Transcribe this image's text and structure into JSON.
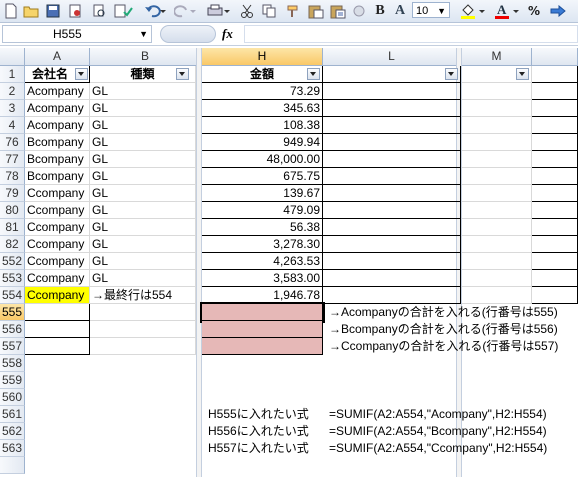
{
  "toolbar": {
    "font_size": "10",
    "buttons": [
      "new-icon",
      "open-icon",
      "save-icon",
      "permission-icon",
      "print-preview-icon",
      "spelling-icon",
      "undo-icon",
      "redo-icon",
      "print-icon",
      "cut-icon",
      "copy-icon",
      "format-painter-icon",
      "paste-icon",
      "paste-special-icon",
      "circle-icon",
      "bold-icon",
      "font-icon",
      "font-color-icon",
      "percent-icon",
      "arrow-icon"
    ],
    "bold_label": "B",
    "font_label": "A",
    "percent_label": "%"
  },
  "formula_bar": {
    "name_box": "H555",
    "fx_label": "fx",
    "value": ""
  },
  "columns": [
    {
      "label": "A"
    },
    {
      "label": "B"
    },
    {
      "label": "H"
    },
    {
      "label": "L"
    },
    {
      "label": "M"
    }
  ],
  "header_row": {
    "row": "1",
    "a": "会社名",
    "b": "種類",
    "h": "金額",
    "l": "",
    "m": ""
  },
  "data_rows": [
    {
      "row": "2",
      "a": "Acompany",
      "b": "GL",
      "h": "73.29"
    },
    {
      "row": "3",
      "a": "Acompany",
      "b": "GL",
      "h": "345.63"
    },
    {
      "row": "4",
      "a": "Acompany",
      "b": "GL",
      "h": "108.38"
    },
    {
      "row": "76",
      "a": "Bcompany",
      "b": "GL",
      "h": "949.94"
    },
    {
      "row": "77",
      "a": "Bcompany",
      "b": "GL",
      "h": "48,000.00"
    },
    {
      "row": "78",
      "a": "Bcompany",
      "b": "GL",
      "h": "675.75"
    },
    {
      "row": "79",
      "a": "Ccompany",
      "b": "GL",
      "h": "139.67"
    },
    {
      "row": "80",
      "a": "Ccompany",
      "b": "GL",
      "h": "479.09"
    },
    {
      "row": "81",
      "a": "Ccompany",
      "b": "GL",
      "h": "56.38"
    },
    {
      "row": "82",
      "a": "Ccompany",
      "b": "GL",
      "h": "3,278.30"
    },
    {
      "row": "552",
      "a": "Ccompany",
      "b": "GL",
      "h": "4,263.53"
    },
    {
      "row": "553",
      "a": "Ccompany",
      "b": "GL",
      "h": "3,583.00"
    },
    {
      "row": "554",
      "a": "Ccompany",
      "b": "→最終行は554",
      "h": "1,946.78"
    }
  ],
  "sum_rows": [
    {
      "row": "555",
      "note": "→Acompanyの合計を入れる(行番号は555)"
    },
    {
      "row": "556",
      "note": "→Bcompanyの合計を入れる(行番号は556)"
    },
    {
      "row": "557",
      "note": "→Ccompanyの合計を入れる(行番号は557)"
    }
  ],
  "empty_rows": [
    "558",
    "559",
    "560"
  ],
  "formula_rows": [
    {
      "row": "561",
      "label": "H555に入れたい式",
      "formula": "=SUMIF(A2:A554,\"Acompany\",H2:H554)"
    },
    {
      "row": "562",
      "label": "H556に入れたい式",
      "formula": "=SUMIF(A2:A554,\"Bcompany\",H2:H554)"
    },
    {
      "row": "563",
      "label": "H557に入れたい式",
      "formula": "=SUMIF(A2:A554,\"Ccompany\",H2:H554)"
    }
  ],
  "colors": {
    "highlight_yellow": "#ffff00",
    "sum_cell_pink": "#e6b8b7",
    "selection_header": "#f9c867"
  }
}
